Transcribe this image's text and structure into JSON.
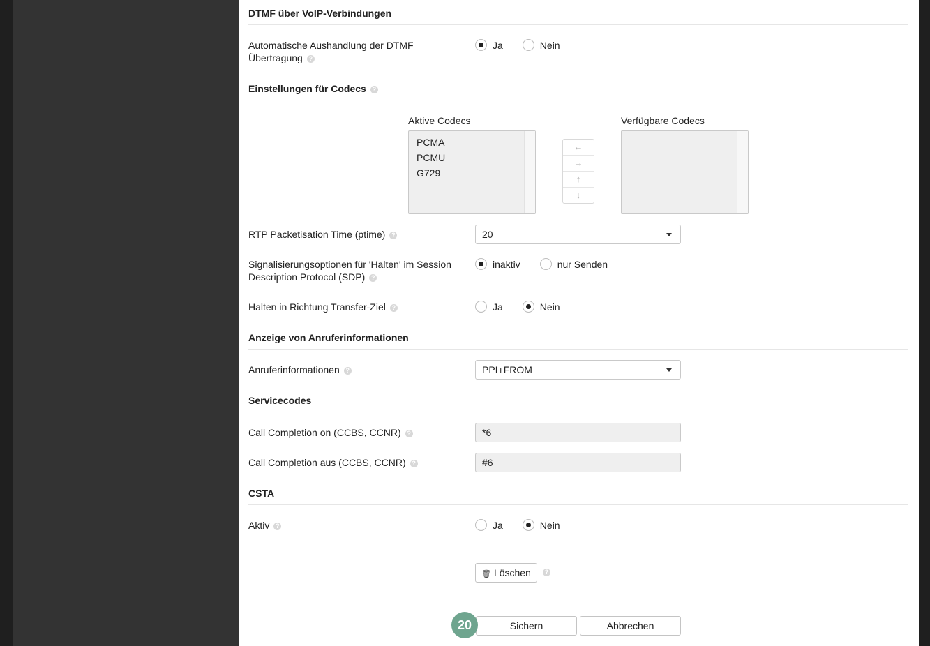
{
  "sections": {
    "dtmf": "DTMF über VoIP-Verbindungen",
    "codecs": "Einstellungen für Codecs",
    "caller_info": "Anzeige von Anruferinformationen",
    "service_codes": "Servicecodes",
    "csta": "CSTA"
  },
  "dtmf": {
    "label_line1": "Automatische Aushandlung der DTMF",
    "label_line2": "Übertragung",
    "options": [
      "Ja",
      "Nein"
    ],
    "selected": "Ja"
  },
  "codecs": {
    "active_title": "Aktive Codecs",
    "available_title": "Verfügbare Codecs",
    "active": [
      "PCMA",
      "PCMU",
      "G729"
    ],
    "available": [],
    "arrows": [
      "←",
      "→",
      "↑",
      "↓"
    ]
  },
  "ptime": {
    "label": "RTP Packetisation Time (ptime)",
    "value": "20"
  },
  "hold_sdp": {
    "label_line1": "Signalisierungsoptionen für 'Halten' im Session",
    "label_line2": "Description Protocol (SDP)",
    "options": [
      "inaktiv",
      "nur Senden"
    ],
    "selected": "inaktiv"
  },
  "hold_transfer": {
    "label": "Halten in Richtung Transfer-Ziel",
    "options": [
      "Ja",
      "Nein"
    ],
    "selected": "Nein"
  },
  "caller_info": {
    "label": "Anruferinformationen",
    "value": "PPI+FROM"
  },
  "cc_on": {
    "label": "Call Completion on (CCBS, CCNR)",
    "value": "*6"
  },
  "cc_off": {
    "label": "Call Completion aus (CCBS, CCNR)",
    "value": "#6"
  },
  "csta": {
    "label": "Aktiv",
    "options": [
      "Ja",
      "Nein"
    ],
    "selected": "Nein"
  },
  "buttons": {
    "delete": "Löschen",
    "save": "Sichern",
    "cancel": "Abbrechen"
  },
  "badge": "20",
  "help_glyph": "?",
  "trash_glyph": "🗑",
  "colors": {
    "badge": "#6fa58f",
    "sidebar": "#333333",
    "panel": "#ffffff"
  }
}
